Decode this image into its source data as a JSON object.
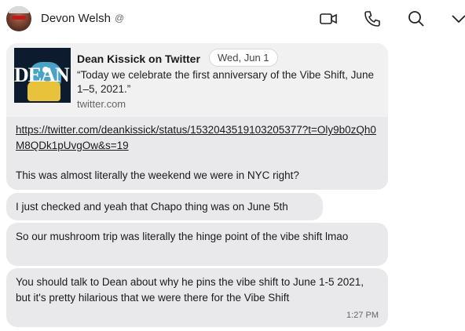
{
  "header": {
    "contact_name": "Devon Welsh",
    "badge": "@",
    "icons": [
      "video-icon",
      "phone-icon",
      "search-icon",
      "chevron-down-icon"
    ]
  },
  "tweet_card": {
    "image_text": "DEAN",
    "title": "Dean Kissick on Twitter",
    "date": "Wed, Jun 1",
    "text": "“Today we celebrate the first anniversary of the Vibe Shift, June 1–5, 2021.”",
    "domain": "twitter.com"
  },
  "messages": [
    {
      "link": "https://twitter.com/deankissick/status/1532043519103205377?t=Oly9b0zQh0M8QDk1pUvgOw&s=19",
      "text": "This was almost literally the weekend we were in NYC right?"
    },
    {
      "text": "I just checked and yeah that Chapo thing was on June 5th"
    },
    {
      "text": "So our mushroom trip was literally the hinge point of the vibe shift lmao"
    },
    {
      "text": "You should talk to Dean about why he pins the vibe shift to June 1-5 2021, but it's pretty hilarious that we were there for the Vibe Shift",
      "time": "1:27 PM"
    }
  ],
  "colors": {
    "bubble": "#e9e9eb",
    "card": "#f1f1f2",
    "text": "#1a1a1a",
    "muted": "#666666"
  }
}
